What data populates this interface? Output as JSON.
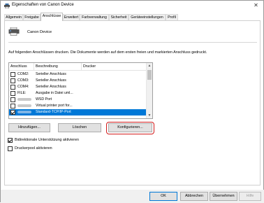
{
  "window": {
    "title": "Eigenschaften von Canon Device",
    "close_glyph": "✕"
  },
  "tabs": [
    {
      "label": "Allgemein"
    },
    {
      "label": "Freigabe"
    },
    {
      "label": "Anschlüsse"
    },
    {
      "label": "Erweitert"
    },
    {
      "label": "Farbverwaltung"
    },
    {
      "label": "Sicherheit"
    },
    {
      "label": "Geräteeinstellungen"
    },
    {
      "label": "Profil"
    }
  ],
  "active_tab": "Anschlüsse",
  "device": {
    "name": "Canon Device",
    "icon": "printer-icon"
  },
  "description": "Auf folgenden Anschlüssen drucken. Die Dokumente werden auf dem ersten freien und markierten Anschluss gedruckt.",
  "ports_table": {
    "headers": {
      "port": "Anschluss",
      "description": "Beschreibung",
      "printer": "Drucker"
    },
    "rows": [
      {
        "port": "COM2:",
        "description": "Serieller Anschluss",
        "printer": "",
        "checked": false,
        "selected": false
      },
      {
        "port": "COM3:",
        "description": "Serieller Anschluss",
        "printer": "",
        "checked": false,
        "selected": false
      },
      {
        "port": "COM4:",
        "description": "Serieller Anschluss",
        "printer": "",
        "checked": false,
        "selected": false
      },
      {
        "port": "FILE:",
        "description": "Ausgabe in Datei uml...",
        "printer": "",
        "checked": false,
        "selected": false
      },
      {
        "port": "",
        "description": "WSD Port",
        "printer": "",
        "checked": false,
        "selected": false
      },
      {
        "port": "",
        "description": "Virtual printer port for...",
        "printer": "",
        "checked": false,
        "selected": false
      },
      {
        "port": "",
        "description": "Standard-TCP/IP-Port",
        "printer": "",
        "checked": true,
        "selected": true
      }
    ]
  },
  "port_buttons": {
    "add": "Hinzufügen...",
    "delete": "Löschen",
    "configure": "Konfigurieren..."
  },
  "options": {
    "bidirectional": {
      "label": "Bidirektionale Unterstützung aktivieren",
      "checked": true
    },
    "pooling": {
      "label": "Druckerpool aktivieren",
      "checked": false
    }
  },
  "dialog_buttons": {
    "ok": "OK",
    "cancel": "Abbrechen",
    "apply": "Übernehmen",
    "help": "Hilfe"
  },
  "colors": {
    "selection": "#0078d7",
    "highlight_ring": "#d11a1a"
  }
}
